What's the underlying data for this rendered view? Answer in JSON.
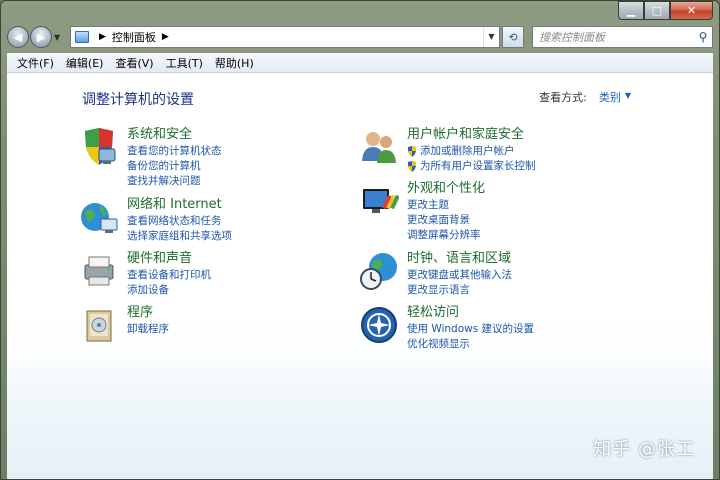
{
  "window": {
    "caption_buttons": [
      "minimize",
      "maximize",
      "close"
    ]
  },
  "navbar": {
    "address_path": [
      "控制面板"
    ],
    "search_placeholder": "搜索控制面板"
  },
  "menu": [
    "文件(F)",
    "编辑(E)",
    "查看(V)",
    "工具(T)",
    "帮助(H)"
  ],
  "page": {
    "title": "调整计算机的设置",
    "view_by_label": "查看方式:",
    "view_by_value": "类别"
  },
  "categories": [
    {
      "icon": "system-security-icon",
      "title": "系统和安全",
      "links": [
        "查看您的计算机状态",
        "备份您的计算机",
        "查找并解决问题"
      ]
    },
    {
      "icon": "network-internet-icon",
      "title": "网络和 Internet",
      "links": [
        "查看网络状态和任务",
        "选择家庭组和共享选项"
      ]
    },
    {
      "icon": "hardware-sound-icon",
      "title": "硬件和声音",
      "links": [
        "查看设备和打印机",
        "添加设备"
      ]
    },
    {
      "icon": "programs-icon",
      "title": "程序",
      "links": [
        "卸载程序"
      ]
    },
    {
      "icon": "user-accounts-icon",
      "title": "用户帐户和家庭安全",
      "links": [
        "添加或删除用户帐户",
        "为所有用户设置家长控制"
      ],
      "shielded": [
        true,
        true
      ]
    },
    {
      "icon": "appearance-icon",
      "title": "外观和个性化",
      "links": [
        "更改主题",
        "更改桌面背景",
        "调整屏幕分辨率"
      ]
    },
    {
      "icon": "clock-language-icon",
      "title": "时钟、语言和区域",
      "links": [
        "更改键盘或其他输入法",
        "更改显示语言"
      ]
    },
    {
      "icon": "ease-of-access-icon",
      "title": "轻松访问",
      "links": [
        "使用 Windows 建议的设置",
        "优化视频显示"
      ]
    }
  ],
  "watermark": "知乎 @张工",
  "colors": {
    "title": "#1e3287",
    "category_title": "#1e6b2e",
    "link": "#1f56a8"
  }
}
